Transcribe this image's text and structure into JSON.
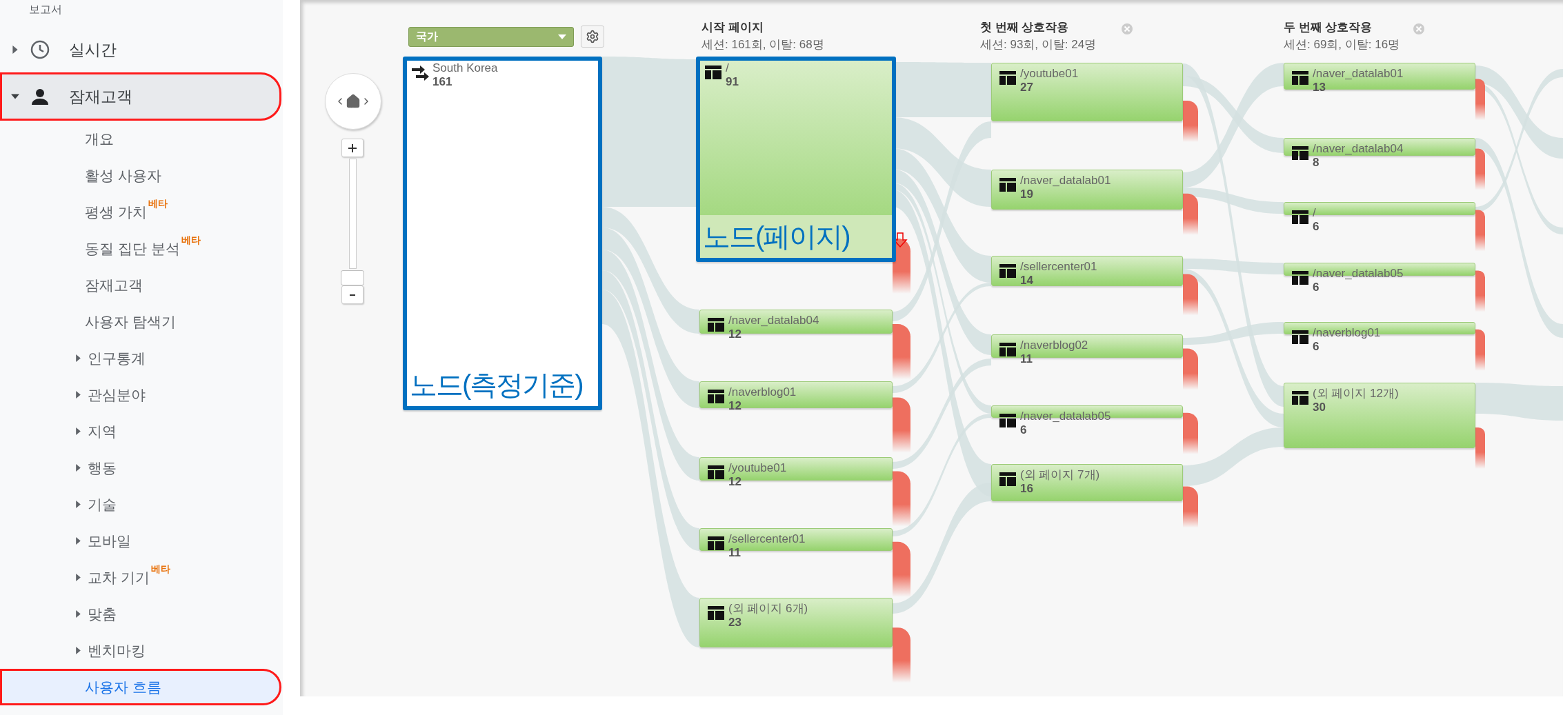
{
  "sidebar": {
    "section_title": "보고서",
    "items": [
      {
        "label": "실시간",
        "expanded": false,
        "selected": false,
        "outlined": false
      },
      {
        "label": "잠재고객",
        "expanded": true,
        "selected": true,
        "outlined": true,
        "children": [
          {
            "label": "개요",
            "kind": "page",
            "selected": false,
            "outlined": false
          },
          {
            "label": "활성 사용자",
            "kind": "page",
            "selected": false,
            "outlined": false
          },
          {
            "label": "평생 가치",
            "kind": "page",
            "badge": "베타",
            "selected": false,
            "outlined": false
          },
          {
            "label": "동질 집단 분석",
            "kind": "page",
            "badge": "베타",
            "selected": false,
            "outlined": false
          },
          {
            "label": "잠재고객",
            "kind": "page",
            "selected": false,
            "outlined": false
          },
          {
            "label": "사용자 탐색기",
            "kind": "page",
            "selected": false,
            "outlined": false
          },
          {
            "label": "인구통계",
            "kind": "group",
            "selected": false,
            "outlined": false
          },
          {
            "label": "관심분야",
            "kind": "group",
            "selected": false,
            "outlined": false
          },
          {
            "label": "지역",
            "kind": "group",
            "selected": false,
            "outlined": false
          },
          {
            "label": "행동",
            "kind": "group",
            "selected": false,
            "outlined": false
          },
          {
            "label": "기술",
            "kind": "group",
            "selected": false,
            "outlined": false
          },
          {
            "label": "모바일",
            "kind": "group",
            "selected": false,
            "outlined": false
          },
          {
            "label": "교차 기기",
            "kind": "group",
            "badge": "베타",
            "selected": false,
            "outlined": false
          },
          {
            "label": "맞춤",
            "kind": "group",
            "selected": false,
            "outlined": false
          },
          {
            "label": "벤치마킹",
            "kind": "group",
            "selected": false,
            "outlined": false
          },
          {
            "label": "사용자 흐름",
            "kind": "page",
            "selected": true,
            "outlined": true
          }
        ]
      }
    ]
  },
  "flow": {
    "dimension_select": {
      "value": "국가"
    },
    "columns": [
      {
        "kind": "dimension",
        "nodes": [
          {
            "label": "South Korea",
            "count": "161",
            "annotation": "노드(측정기준)"
          }
        ]
      },
      {
        "kind": "page",
        "title": "시작 페이지",
        "summary": "세션: 161회, 이탈: 68명",
        "closable": false,
        "nodes": [
          {
            "label": "/",
            "count": "91",
            "annotation": "노드(페이지)"
          },
          {
            "label": "/naver_datalab04",
            "count": "12"
          },
          {
            "label": "/naverblog01",
            "count": "12"
          },
          {
            "label": "/youtube01",
            "count": "12"
          },
          {
            "label": "/sellercenter01",
            "count": "11"
          },
          {
            "label": "(외 페이지 6개)",
            "count": "23"
          }
        ]
      },
      {
        "kind": "page",
        "title": "첫 번째 상호작용",
        "summary": "세션: 93회, 이탈: 24명",
        "closable": true,
        "nodes": [
          {
            "label": "/youtube01",
            "count": "27"
          },
          {
            "label": "/naver_datalab01",
            "count": "19"
          },
          {
            "label": "/sellercenter01",
            "count": "14"
          },
          {
            "label": "/naverblog02",
            "count": "11"
          },
          {
            "label": "/naver_datalab05",
            "count": "6"
          },
          {
            "label": "(외 페이지 7개)",
            "count": "16"
          }
        ]
      },
      {
        "kind": "page",
        "title": "두 번째 상호작용",
        "summary": "세션: 69회, 이탈: 16명",
        "closable": true,
        "nodes": [
          {
            "label": "/naver_datalab01",
            "count": "13"
          },
          {
            "label": "/naver_datalab04",
            "count": "8"
          },
          {
            "label": "/",
            "count": "6"
          },
          {
            "label": "/naver_datalab05",
            "count": "6"
          },
          {
            "label": "/naverblog01",
            "count": "6"
          },
          {
            "label": "(외 페이지 12개)",
            "count": "30"
          }
        ]
      }
    ]
  }
}
